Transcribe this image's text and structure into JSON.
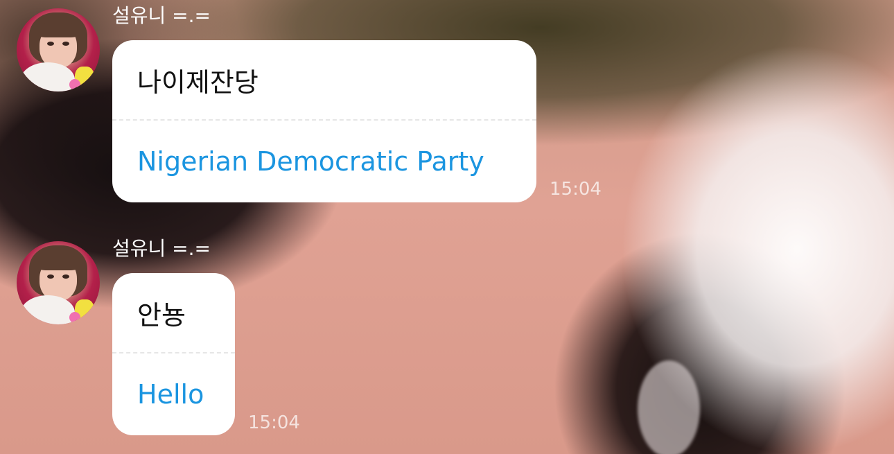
{
  "messages": [
    {
      "sender": "설유니 =.=",
      "original": "나이제잔당",
      "translation": "Nigerian Democratic Party",
      "time": "15:04"
    },
    {
      "sender": "설유니 =.=",
      "original": "안뇽",
      "translation": "Hello",
      "time": "15:04"
    }
  ],
  "colors": {
    "bubble": "#ffffff",
    "original_text": "#111111",
    "translation_text": "#1b95e0",
    "sender_text": "#ffffff",
    "timestamp_text": "#e9dcd6"
  }
}
